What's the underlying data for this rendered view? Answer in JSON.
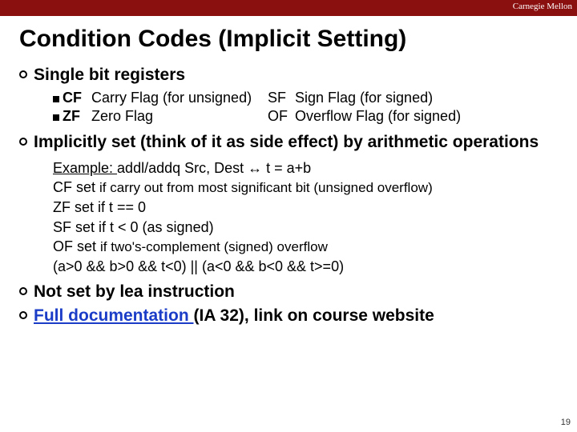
{
  "header": {
    "brand": "Carnegie Mellon"
  },
  "title": "Condition Codes (Implicit Setting)",
  "bullets": {
    "b1": "Single bit registers",
    "b2": "Implicitly set (think of it as side effect) by arithmetic operations",
    "b3": "Not set by lea instruction",
    "b4_link": "Full documentation ",
    "b4_tail": "(IA 32), link on course website"
  },
  "flags": {
    "cf_code": "CF",
    "cf_desc": "Carry Flag (for unsigned)",
    "sf_code": "SF",
    "sf_desc": "Sign Flag (for signed)",
    "zf_code": "ZF",
    "zf_desc": "Zero Flag",
    "of_code": "OF",
    "of_desc": "Overflow Flag (for signed)"
  },
  "example": {
    "line1_a": "Example: ",
    "line1_b": "addl/addq Src, Dest ↔ t = a+b",
    "line2_a": "CF set ",
    "line2_b": "if carry out from most significant bit (unsigned overflow)",
    "line3_a": "ZF set ",
    "line3_b": "if t == 0",
    "line4_a": "SF set ",
    "line4_b": "if t < 0 (as signed)",
    "line5_a": "OF set ",
    "line5_b": "if two's-complement (signed) overflow",
    "line6": "(a>0 && b>0 && t<0) || (a<0 && b<0 && t>=0)"
  },
  "page": "19"
}
